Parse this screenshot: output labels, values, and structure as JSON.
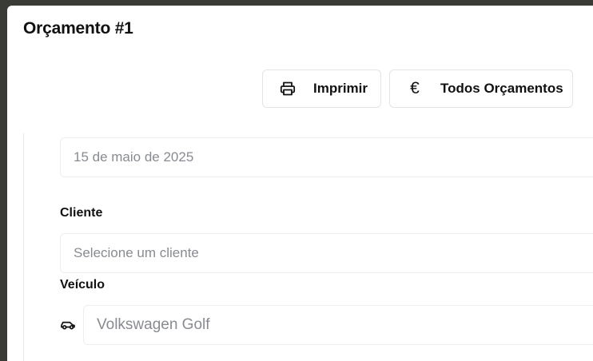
{
  "modal": {
    "title": "Orçamento #1"
  },
  "toolbar": {
    "print_label": "Imprimir",
    "all_quotes_label": "Todos Orçamentos",
    "all_quotes_icon_glyph": "€"
  },
  "form": {
    "date_value": "15 de maio de 2025",
    "client_label": "Cliente",
    "client_placeholder": "Selecione um cliente",
    "vehicle_label": "Veículo",
    "vehicle_value": "Volkswagen Golf"
  },
  "icons": {
    "print": "printer-icon",
    "all_quotes": "euro-icon",
    "vehicle": "car-icon"
  },
  "colors": {
    "text_primary": "#111111",
    "text_muted": "#888b91",
    "border": "#e2e4e8",
    "backdrop": "#3a3a36"
  }
}
